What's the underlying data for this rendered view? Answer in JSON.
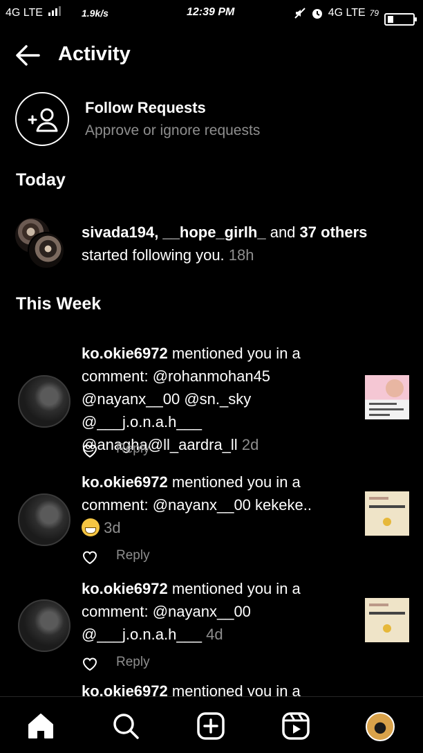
{
  "status_bar": {
    "network_left": "4G LTE",
    "speed": "1.9k/s",
    "time": "12:39 PM",
    "network_right": "4G LTE",
    "battery": "79"
  },
  "header": {
    "title": "Activity"
  },
  "follow_requests": {
    "title": "Follow Requests",
    "subtitle": "Approve or ignore requests"
  },
  "sections": {
    "today": "Today",
    "this_week": "This Week"
  },
  "follow_notification": {
    "users": "sivada194, __hope_girlh_",
    "connector": "and",
    "others": "37 others",
    "action": "started following you.",
    "time": "18h"
  },
  "mentions": [
    {
      "username": "ko.okie6972",
      "text": "mentioned you in a comment: @rohanmohan45 @nayanx__00 @sn._sky @___j.o.n.a.h___ @anagha@ll_aardra_ll",
      "time": "2d",
      "reply_label": "Reply"
    },
    {
      "username": "ko.okie6972",
      "text": "mentioned you in a comment: @nayanx__00 kekeke..",
      "time": "3d",
      "reply_label": "Reply"
    },
    {
      "username": "ko.okie6972",
      "text": "mentioned you in a comment: @nayanx__00 @___j.o.n.a.h___",
      "time": "4d",
      "reply_label": "Reply"
    }
  ],
  "partial_row": {
    "username": "ko.okie6972",
    "text": "mentioned you in a"
  },
  "nav": {
    "items": [
      "home-icon",
      "search-icon",
      "create-icon",
      "reels-icon",
      "profile-avatar"
    ]
  }
}
